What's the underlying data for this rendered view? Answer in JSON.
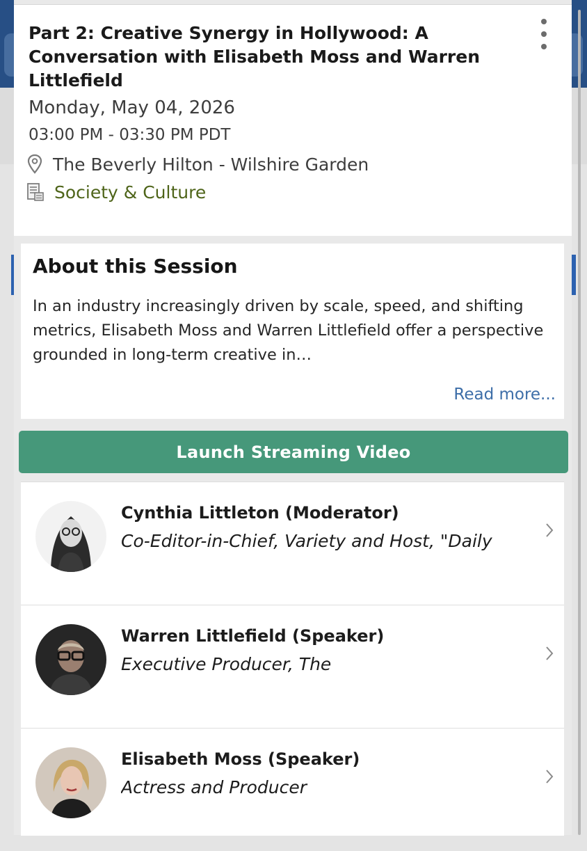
{
  "event": {
    "title": "Part 2: Creative Synergy in Hollywood: A Conversation with Elisabeth Moss and Warren Littlefield",
    "date": "Monday, May 04, 2026",
    "time": "03:00 PM - 03:30 PM PDT",
    "location": "The Beverly Hilton - Wilshire Garden",
    "track": "Society & Culture",
    "location_icon": "map-pin-icon",
    "track_icon": "document-list-icon",
    "menu_icon": "more-vertical-icon"
  },
  "about": {
    "heading": "About this Session",
    "body": "In an industry increasingly driven by scale, speed, and shifting metrics, Elisabeth Moss and Warren Littlefield offer a perspective grounded in long-term creative in…",
    "read_more": "Read more..."
  },
  "actions": {
    "launch_label": "Launch Streaming Video"
  },
  "speakers": [
    {
      "name": "Cynthia Littleton (Moderator)",
      "title": "Co-Editor-in-Chief, Variety and Host, \"Daily"
    },
    {
      "name": "Warren Littlefield (Speaker)",
      "title": "Executive Producer, The"
    },
    {
      "name": "Elisabeth Moss (Speaker)",
      "title": "Actress and Producer"
    }
  ],
  "colors": {
    "track": "#4e6419",
    "link": "#3d6ea8",
    "launch_button": "#46987a",
    "header": "#274f85"
  }
}
